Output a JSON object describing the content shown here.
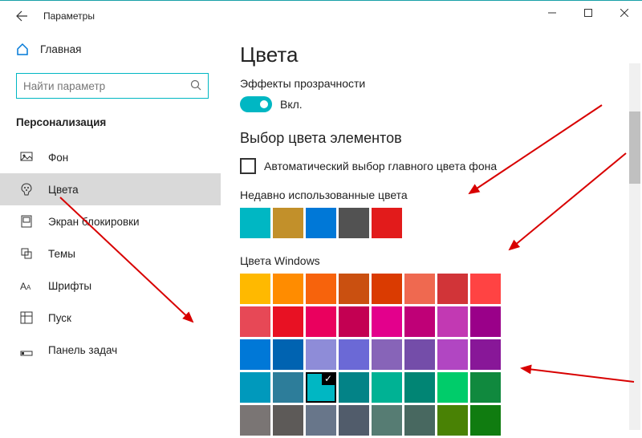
{
  "titlebar": {
    "title": "Параметры"
  },
  "sidebar": {
    "home": "Главная",
    "search_placeholder": "Найти параметр",
    "section": "Персонализация",
    "items": [
      {
        "label": "Фон"
      },
      {
        "label": "Цвета",
        "selected": true
      },
      {
        "label": "Экран блокировки"
      },
      {
        "label": "Темы"
      },
      {
        "label": "Шрифты"
      },
      {
        "label": "Пуск"
      },
      {
        "label": "Панель задач"
      }
    ]
  },
  "main": {
    "heading": "Цвета",
    "transparency_label": "Эффекты прозрачности",
    "toggle_state": "Вкл.",
    "accent_heading": "Выбор цвета элементов",
    "auto_checkbox": "Автоматический выбор главного цвета фона",
    "recent_label": "Недавно использованные цвета",
    "recent_colors": [
      "#00b7c3",
      "#c2902a",
      "#0078d7",
      "#525252",
      "#e21b1b"
    ],
    "windows_label": "Цвета Windows",
    "windows_grid": [
      [
        "#ffb900",
        "#ff8c00",
        "#f7630c",
        "#ca5010",
        "#da3b01",
        "#ef6950",
        "#d13438",
        "#ff4343"
      ],
      [
        "#e74856",
        "#e81123",
        "#ea005e",
        "#c30052",
        "#e3008c",
        "#bf0077",
        "#c239b3",
        "#9a0089"
      ],
      [
        "#0078d7",
        "#0063b1",
        "#8e8cd8",
        "#6b69d6",
        "#8764b8",
        "#744da9",
        "#b146c2",
        "#881798"
      ],
      [
        "#0099bc",
        "#2d7d9a",
        "#00b7c3",
        "#038387",
        "#00b294",
        "#018574",
        "#00cc6a",
        "#10893e"
      ],
      [
        "#7a7574",
        "#5d5a58",
        "#68768a",
        "#515c6b",
        "#567c73",
        "#486860",
        "#498205",
        "#107c10"
      ]
    ],
    "selected_color": [
      3,
      2
    ]
  }
}
